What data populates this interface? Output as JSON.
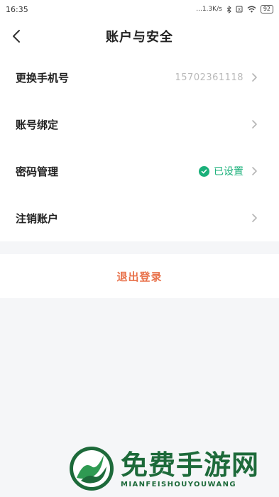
{
  "status_bar": {
    "time": "16:35",
    "network_speed": "...1.3K/s",
    "battery": "92"
  },
  "nav": {
    "title": "账户与安全"
  },
  "rows": [
    {
      "label": "更换手机号",
      "value": "15702361118"
    },
    {
      "label": "账号绑定"
    },
    {
      "label": "密码管理",
      "status": "已设置"
    },
    {
      "label": "注销账户"
    }
  ],
  "logout_label": "退出登录",
  "colors": {
    "accent_orange": "#e8714a",
    "status_green": "#1ab07a",
    "background": "#f5f6f8"
  },
  "watermark": {
    "text_cn": "免费手游网",
    "text_en": "MIANFEISHOUYOUWANG"
  }
}
